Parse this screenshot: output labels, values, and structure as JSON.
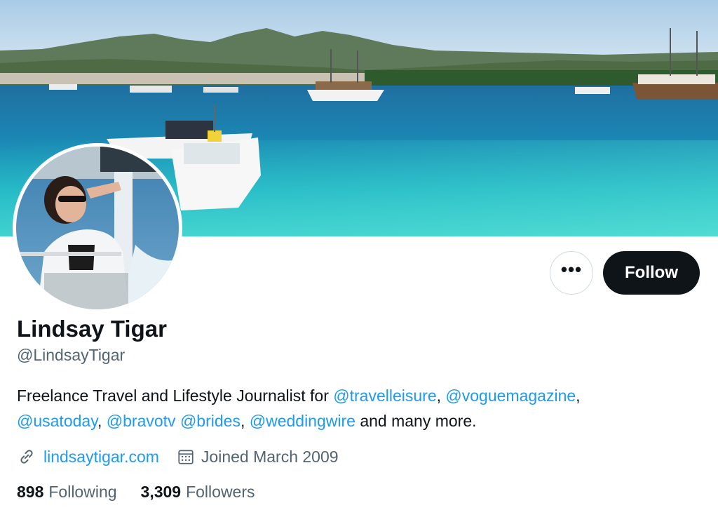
{
  "profile": {
    "display_name": "Lindsay Tigar",
    "handle": "@LindsayTigar"
  },
  "bio": {
    "parts": [
      {
        "text": "Freelance Travel and Lifestyle Journalist for ",
        "mention": false
      },
      {
        "text": "@travelleisure",
        "mention": true
      },
      {
        "text": ", ",
        "mention": false
      },
      {
        "text": "@voguemagazine",
        "mention": true
      },
      {
        "text": ", ",
        "mention": false
      },
      {
        "text": "@usatoday",
        "mention": true
      },
      {
        "text": ", ",
        "mention": false
      },
      {
        "text": "@bravotv",
        "mention": true
      },
      {
        "text": " ",
        "mention": false
      },
      {
        "text": "@brides",
        "mention": true
      },
      {
        "text": ", ",
        "mention": false
      },
      {
        "text": "@weddingwire",
        "mention": true
      },
      {
        "text": " and many more.",
        "mention": false
      }
    ]
  },
  "meta": {
    "website": "lindsaytigar.com",
    "website_icon": "link-icon",
    "joined": "Joined March 2009",
    "joined_icon": "calendar-icon"
  },
  "stats": {
    "following_count": "898",
    "following_label": "Following",
    "followers_count": "3,309",
    "followers_label": "Followers"
  },
  "actions": {
    "more_label": "•••",
    "follow_label": "Follow"
  },
  "colors": {
    "accent": "#1d9bf0",
    "text_primary": "#0f1419",
    "text_secondary": "#536471",
    "follow_button_bg": "#0f1419"
  }
}
